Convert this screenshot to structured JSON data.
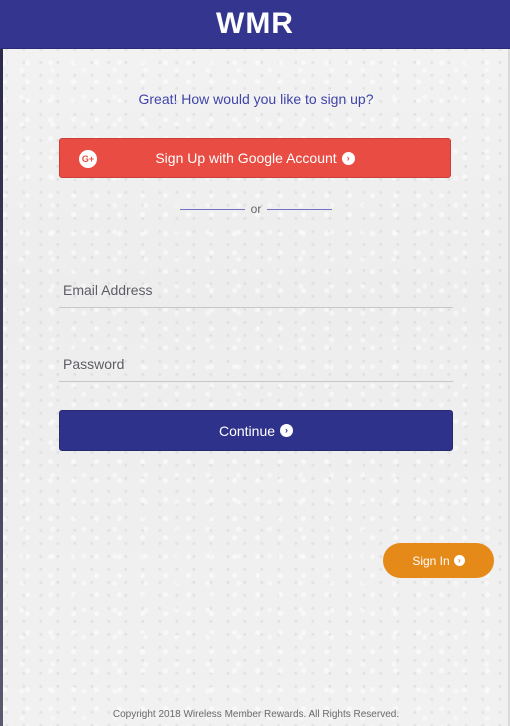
{
  "header": {
    "logo": "WMR"
  },
  "signup": {
    "prompt": "Great! How would you like to sign up?",
    "google_label": "Sign Up with Google Account",
    "google_icon": "google-plus-icon",
    "divider_text": "or"
  },
  "form": {
    "email_placeholder": "Email Address",
    "email_value": "",
    "password_placeholder": "Password",
    "password_value": "",
    "continue_label": "Continue"
  },
  "signin": {
    "label": "Sign In"
  },
  "footer": {
    "copyright": "Copyright 2018 Wireless Member Rewards. All Rights Reserved."
  },
  "colors": {
    "header_bg": "#33358f",
    "google_red": "#e84c43",
    "primary_navy": "#2f328a",
    "signin_orange": "#e58a18",
    "prompt_text": "#3f45a8"
  }
}
